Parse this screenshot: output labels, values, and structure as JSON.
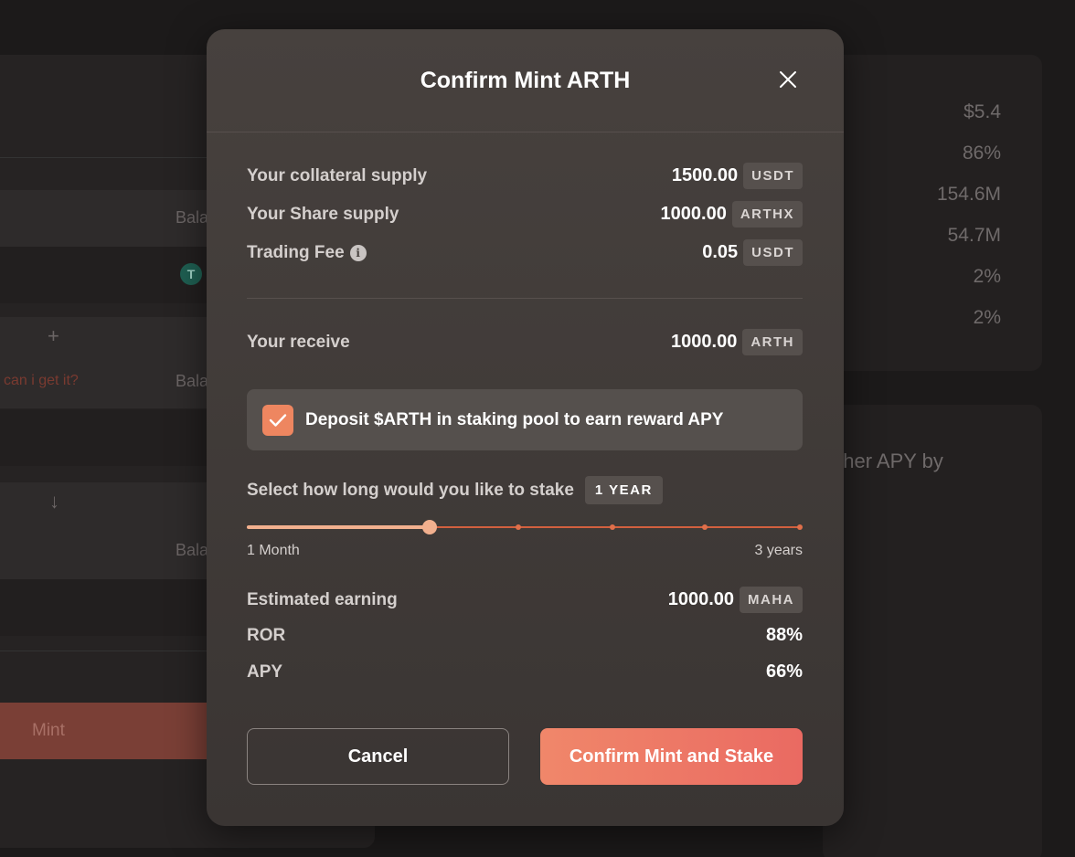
{
  "background": {
    "balance_label": "Bala",
    "help_link": "can i get it?",
    "mint_button": "Mint",
    "coin_symbol": "T",
    "stats": [
      "$5.4",
      "86%",
      "154.6M",
      "54.7M",
      "2%",
      "2%"
    ],
    "apy_text": "gher APY by"
  },
  "modal": {
    "title": "Confirm Mint ARTH",
    "collateral": {
      "label": "Your collateral supply",
      "amount": "1500.00",
      "token": "USDT"
    },
    "share": {
      "label": "Your Share supply",
      "amount": "1000.00",
      "token": "ARTHX"
    },
    "fee": {
      "label": "Trading Fee",
      "amount": "0.05",
      "token": "USDT"
    },
    "receive": {
      "label": "Your receive",
      "amount": "1000.00",
      "token": "ARTH"
    },
    "deposit": {
      "label": "Deposit $ARTH in staking pool to earn reward APY",
      "checked": true
    },
    "stake": {
      "label": "Select how long would you like to stake",
      "selected": "1 YEAR",
      "min_label": "1 Month",
      "max_label": "3 years",
      "position": 0.33
    },
    "earning": {
      "label": "Estimated earning",
      "amount": "1000.00",
      "token": "MAHA"
    },
    "ror": {
      "label": "ROR",
      "value": "88%"
    },
    "apy": {
      "label": "APY",
      "value": "66%"
    },
    "cancel_label": "Cancel",
    "confirm_label": "Confirm Mint and Stake",
    "colors": {
      "accent": "#ee8660",
      "accent_end": "#ea6a62"
    }
  }
}
